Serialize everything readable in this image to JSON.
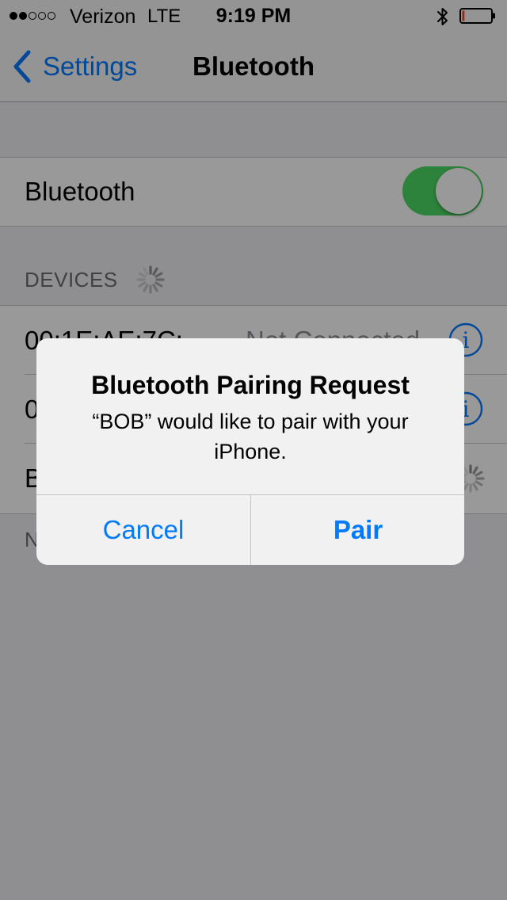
{
  "status_bar": {
    "carrier": "Verizon",
    "network": "LTE",
    "time": "9:19 PM",
    "signal_bars_filled": 2,
    "signal_bars_total": 5,
    "bluetooth_icon": "bluetooth-icon",
    "battery_level": 0.08,
    "battery_color": "#ff3b30"
  },
  "nav": {
    "back_label": "Settings",
    "title": "Bluetooth"
  },
  "bluetooth_row": {
    "label": "Bluetooth",
    "toggle_on": true,
    "toggle_color": "#4cd964"
  },
  "devices": {
    "header": "DEVICES",
    "items": [
      {
        "name": "00:1E:AE:7C:",
        "status": "Not Connected"
      },
      {
        "name": "0"
      },
      {
        "name": "B"
      }
    ]
  },
  "next_section_partial": "N",
  "alert": {
    "title": "Bluetooth Pairing Request",
    "message": "“BOB” would like to pair with your iPhone.",
    "cancel_label": "Cancel",
    "confirm_label": "Pair"
  },
  "accent_color": "#007aff"
}
